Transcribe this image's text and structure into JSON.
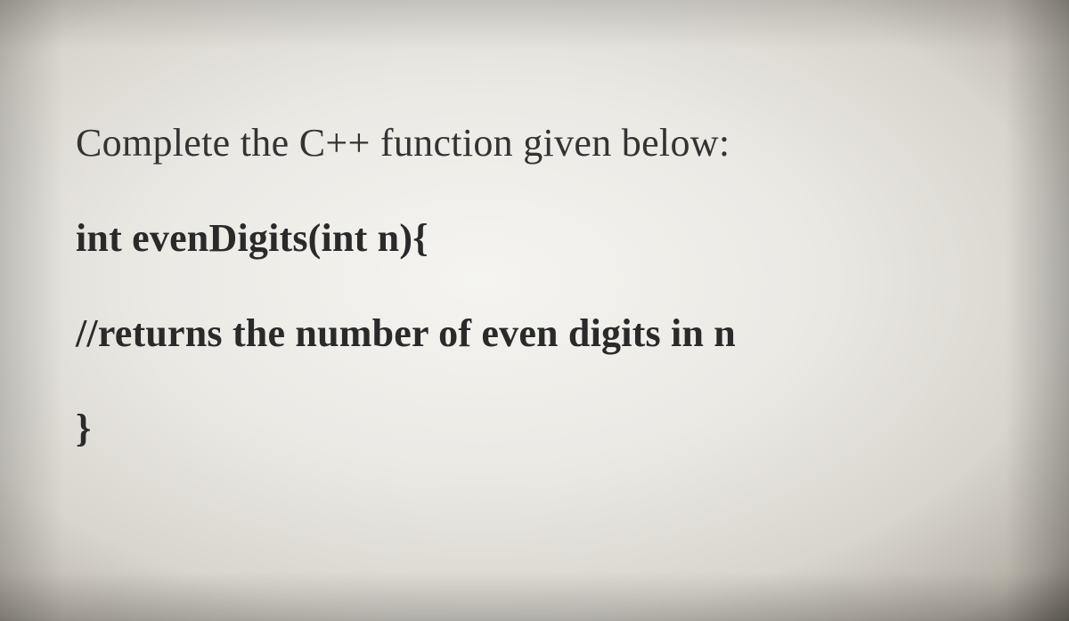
{
  "intro": "Complete the C++ function given below:",
  "code": {
    "line1": "int evenDigits(int n){",
    "line2": "//returns the number of even digits in n",
    "line3": "}"
  }
}
